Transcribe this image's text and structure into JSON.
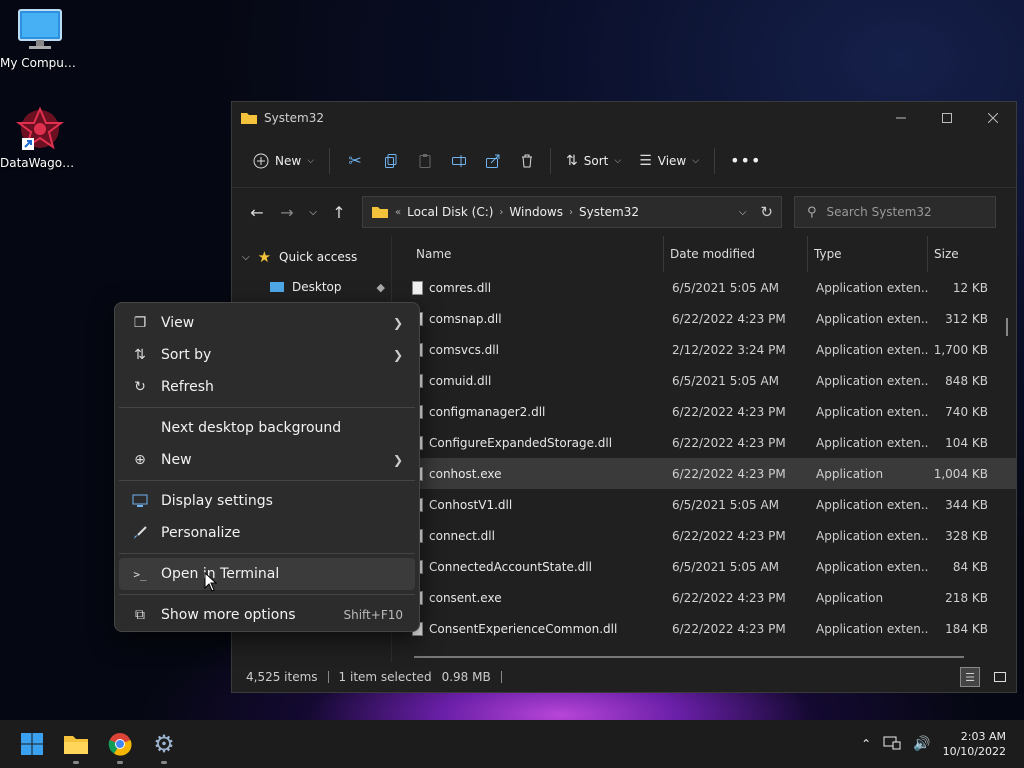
{
  "desktop": {
    "icons": [
      {
        "label": "My Computer"
      },
      {
        "label": "DataWagon..."
      }
    ]
  },
  "window": {
    "title": "System32",
    "toolbar": {
      "new_label": "New",
      "sort_label": "Sort",
      "view_label": "View"
    },
    "address": {
      "crumbs": [
        "Local Disk (C:)",
        "Windows",
        "System32"
      ]
    },
    "search": {
      "placeholder": "Search System32"
    },
    "nav": {
      "quick_access": "Quick access",
      "desktop": "Desktop"
    },
    "columns": {
      "name": "Name",
      "date": "Date modified",
      "type": "Type",
      "size": "Size"
    },
    "files": [
      {
        "name": "comres.dll",
        "date": "6/5/2021 5:05 AM",
        "type": "Application exten...",
        "size": "12 KB"
      },
      {
        "name": "comsnap.dll",
        "date": "6/22/2022 4:23 PM",
        "type": "Application exten...",
        "size": "312 KB"
      },
      {
        "name": "comsvcs.dll",
        "date": "2/12/2022 3:24 PM",
        "type": "Application exten...",
        "size": "1,700 KB"
      },
      {
        "name": "comuid.dll",
        "date": "6/5/2021 5:05 AM",
        "type": "Application exten...",
        "size": "848 KB"
      },
      {
        "name": "configmanager2.dll",
        "date": "6/22/2022 4:23 PM",
        "type": "Application exten...",
        "size": "740 KB"
      },
      {
        "name": "ConfigureExpandedStorage.dll",
        "date": "6/22/2022 4:23 PM",
        "type": "Application exten...",
        "size": "104 KB"
      },
      {
        "name": "conhost.exe",
        "date": "6/22/2022 4:23 PM",
        "type": "Application",
        "size": "1,004 KB"
      },
      {
        "name": "ConhostV1.dll",
        "date": "6/5/2021 5:05 AM",
        "type": "Application exten...",
        "size": "344 KB"
      },
      {
        "name": "connect.dll",
        "date": "6/22/2022 4:23 PM",
        "type": "Application exten...",
        "size": "328 KB"
      },
      {
        "name": "ConnectedAccountState.dll",
        "date": "6/5/2021 5:05 AM",
        "type": "Application exten...",
        "size": "84 KB"
      },
      {
        "name": "consent.exe",
        "date": "6/22/2022 4:23 PM",
        "type": "Application",
        "size": "218 KB"
      },
      {
        "name": "ConsentExperienceCommon.dll",
        "date": "6/22/2022 4:23 PM",
        "type": "Application exten...",
        "size": "184 KB"
      }
    ],
    "status": {
      "items": "4,525 items",
      "selected": "1 item selected",
      "size": "0.98 MB"
    }
  },
  "context_menu": {
    "view": "View",
    "sort_by": "Sort by",
    "refresh": "Refresh",
    "next_bg": "Next desktop background",
    "new": "New",
    "display": "Display settings",
    "personalize": "Personalize",
    "terminal": "Open in Terminal",
    "more": "Show more options",
    "more_shortcut": "Shift+F10"
  },
  "taskbar": {
    "time": "2:03 AM",
    "date": "10/10/2022"
  }
}
